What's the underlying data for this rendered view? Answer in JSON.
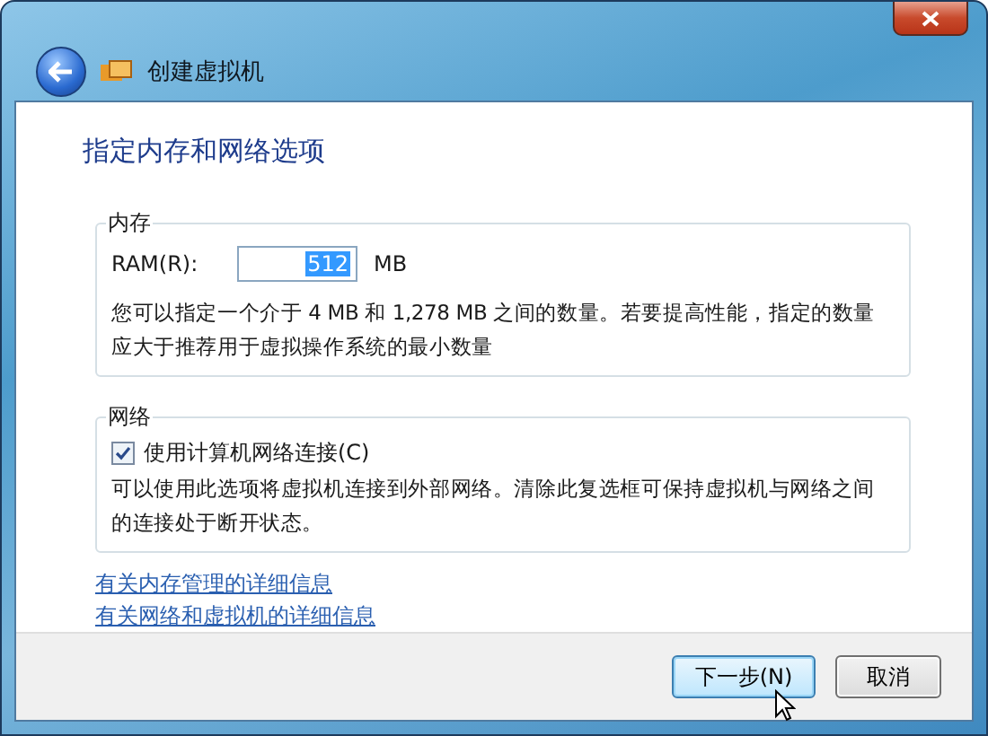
{
  "window": {
    "title": "创建虚拟机"
  },
  "heading": "指定内存和网络选项",
  "memory": {
    "legend": "内存",
    "ram_label": "RAM(R):",
    "ram_value": "512",
    "value_highlighted": true,
    "unit": "MB",
    "description": "您可以指定一个介于 4 MB 和 1,278 MB 之间的数量。若要提高性能，指定的数量应大于推荐用于虚拟操作系统的最小数量"
  },
  "network": {
    "legend": "网络",
    "checkbox": {
      "label": "使用计算机网络连接(C)",
      "checked": true
    },
    "description": "可以使用此选项将虚拟机连接到外部网络。清除此复选框可保持虚拟机与网络之间的连接处于断开状态。"
  },
  "links": [
    "有关内存管理的详细信息",
    "有关网络和虚拟机的详细信息"
  ],
  "buttons": [
    {
      "label": "下一步(N)",
      "default": true
    },
    {
      "label": "取消",
      "default": false
    }
  ]
}
